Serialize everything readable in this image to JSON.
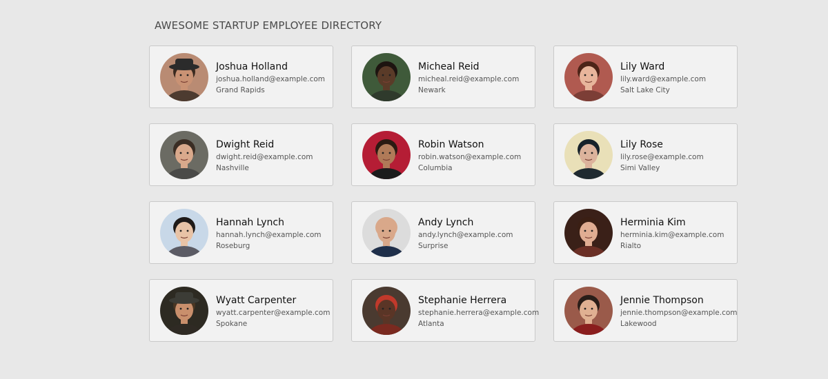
{
  "header": {
    "title": "AWESOME STARTUP EMPLOYEE DIRECTORY"
  },
  "employees": [
    {
      "name": "Joshua Holland",
      "email": "joshua.holland@example.com",
      "city": "Grand Rapids",
      "avatar": {
        "bg": "#b98b73",
        "skin": "#c99274",
        "hair": "#3a2a20",
        "shirt": "#4d3b30",
        "hat": "#2b2b2b"
      }
    },
    {
      "name": "Micheal Reid",
      "email": "micheal.reid@example.com",
      "city": "Newark",
      "avatar": {
        "bg": "#3f5a3a",
        "skin": "#5a3b28",
        "hair": "#1d1410",
        "shirt": "#2f3a2c"
      }
    },
    {
      "name": "Lily Ward",
      "email": "lily.ward@example.com",
      "city": "Salt Lake City",
      "avatar": {
        "bg": "#b05a50",
        "skin": "#e8b59b",
        "hair": "#4d2418",
        "shirt": "#7c3e36"
      }
    },
    {
      "name": "Dwight Reid",
      "email": "dwight.reid@example.com",
      "city": "Nashville",
      "avatar": {
        "bg": "#6b6b63",
        "skin": "#d9a98c",
        "hair": "#3a2d24",
        "shirt": "#4a4a48"
      }
    },
    {
      "name": "Robin Watson",
      "email": "robin.watson@example.com",
      "city": "Columbia",
      "avatar": {
        "bg": "#b51d35",
        "skin": "#b07a58",
        "hair": "#2b1a12",
        "shirt": "#1c1c1c"
      }
    },
    {
      "name": "Lily Rose",
      "email": "lily.rose@example.com",
      "city": "Simi Valley",
      "avatar": {
        "bg": "#e9e0b8",
        "skin": "#dcb39c",
        "hair": "#17222a",
        "shirt": "#1f2a30"
      }
    },
    {
      "name": "Hannah Lynch",
      "email": "hannah.lynch@example.com",
      "city": "Roseburg",
      "avatar": {
        "bg": "#c8d8e8",
        "skin": "#e8c3a6",
        "hair": "#1f1a18",
        "shirt": "#5b5b64"
      }
    },
    {
      "name": "Andy Lynch",
      "email": "andy.lynch@example.com",
      "city": "Surprise",
      "avatar": {
        "bg": "#dcdcdc",
        "skin": "#d9a88a",
        "hair": "#d9a88a",
        "shirt": "#1f2f4a"
      }
    },
    {
      "name": "Herminia Kim",
      "email": "herminia.kim@example.com",
      "city": "Rialto",
      "avatar": {
        "bg": "#3a2018",
        "skin": "#e0ad92",
        "hair": "#3b1f14",
        "shirt": "#6a2f25"
      }
    },
    {
      "name": "Wyatt Carpenter",
      "email": "wyatt.carpenter@example.com",
      "city": "Spokane",
      "avatar": {
        "bg": "#2d2a22",
        "skin": "#c98f6c",
        "hair": "#4a3623",
        "shirt": "#2f2a24",
        "hat": "#3c3c36"
      }
    },
    {
      "name": "Stephanie Herrera",
      "email": "stephanie.herrera@example.com",
      "city": "Atlanta",
      "avatar": {
        "bg": "#4a3a30",
        "skin": "#5a3526",
        "hair": "#c0392b",
        "shirt": "#7a2a20"
      }
    },
    {
      "name": "Jennie Thompson",
      "email": "jennie.thompson@example.com",
      "city": "Lakewood",
      "avatar": {
        "bg": "#9a5a4a",
        "skin": "#e0b092",
        "hair": "#2a1d18",
        "shirt": "#8a1e1e"
      }
    }
  ]
}
